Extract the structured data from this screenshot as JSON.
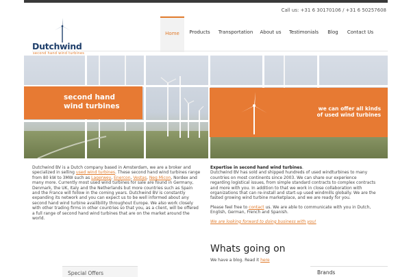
{
  "header": {
    "call_us": "Call us: +31 6 30170106 / +31 6 50257608"
  },
  "logo": {
    "brand": "Dutchwind",
    "tagline": "second hand wind turbines"
  },
  "nav": [
    {
      "label": "Home",
      "active": true
    },
    {
      "label": "Products",
      "active": false
    },
    {
      "label": "Transportation",
      "active": false
    },
    {
      "label": "About us",
      "active": false
    },
    {
      "label": "Testimonials",
      "active": false
    },
    {
      "label": "Blog",
      "active": false
    },
    {
      "label": "Contact Us",
      "active": false
    }
  ],
  "hero": {
    "left_line1": "second hand",
    "left_line2": "wind turbines",
    "right_line1": "we can offer all kinds",
    "right_line2": "of used wind turbines"
  },
  "left_col": {
    "p1": "Dutchwind BV is a Dutch company based in Amsterdam, we are a broker and specialized in selling",
    "link1": "used wind turbines",
    "p2": ". These second hand wind turbines range from 80 kW to 3MW such as",
    "brand1": "Lagerwey",
    "brand2": "Enercon",
    "brand3": "Vestas",
    "brand4": "Neg Micon",
    "p3": ", Nordex  and many more. Currently most used wind turbines for sale are found in Germany, Denmark, the UK, Italy  and the Netherlands but more countries such as Spain and the France will follow in the coming years.  Dutchwind BV is constantly expanding its network and you can expect us to be well informed about any second hand wind turbine availibility  throughout Europe. We also work closely with other trading firms in other countries so that you, as a client, will be offered a full range of second hand wind turbines that are on the market around the world."
  },
  "right_col": {
    "heading": "Expertise in second hand wind turbines",
    "p1": "Dutchwind BV has sold and shipped hundreds of used windturbines to many countries on most continents since 2003. We can share our experience regarding logistical issues, from simple standard contracts to complex contracts and more with you. In addition to that we work in close collaboration with organizations that can re-install and start-up used windmills globally. We are the fasted growing wind turbine marketplace, and we are ready for you.",
    "p2a": "Please feel free to",
    "contact_link": "contact",
    "p2b": "us. We are able to communicate with you in Dutch, English, German, French and Spanish.",
    "closing": "We are looking forward to doing business with you!"
  },
  "whats": {
    "title": "Whats going on",
    "blog_text": "We have a blog. Read it",
    "blog_link": "here"
  },
  "special_offers": "Special Offers",
  "brands": "Brands",
  "colors": {
    "accent": "#e07a2a",
    "brand_blue": "#1f3f6b",
    "orange_panel": "#e77a33"
  }
}
